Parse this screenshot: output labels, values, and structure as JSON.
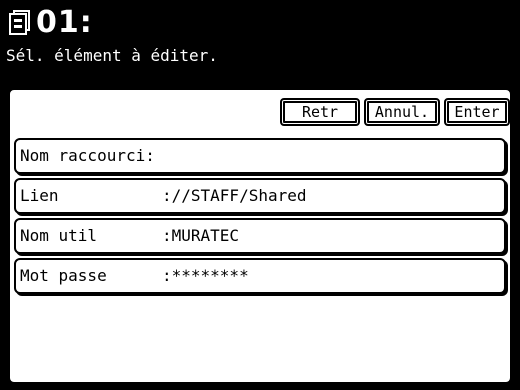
{
  "header": {
    "title": "01:",
    "subtitle": "Sél. élément à éditer."
  },
  "buttons": {
    "back": "Retr",
    "cancel": "Annul.",
    "enter": "Enter"
  },
  "fields": [
    {
      "label": "Nom raccourci:",
      "value": ""
    },
    {
      "label": "Lien",
      "value": "://STAFF/Shared"
    },
    {
      "label": "Nom util",
      "value": ":MURATEC"
    },
    {
      "label": "Mot passe",
      "value": ":********"
    }
  ],
  "icons": {
    "title_icon": "document-icon"
  }
}
